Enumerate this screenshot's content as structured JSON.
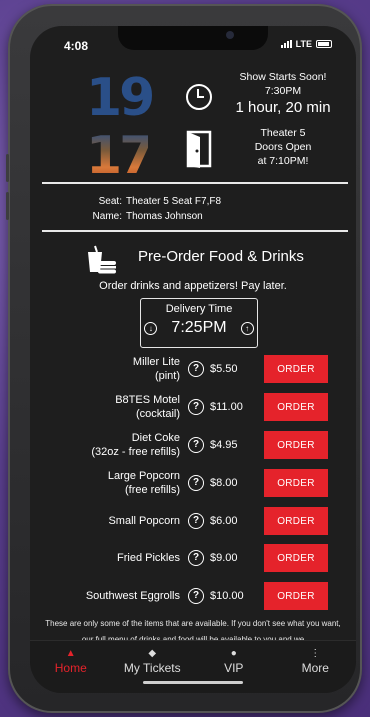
{
  "status": {
    "time": "4:08",
    "network": "LTE"
  },
  "poster": {
    "line1": "19",
    "line2": "17"
  },
  "show": {
    "heading": "Show Starts Soon!",
    "time": "7:30PM",
    "countdown": "1 hour, 20 min"
  },
  "theater": {
    "name": "Theater 5",
    "line2": "Doors Open",
    "line3": "at 7:10PM!"
  },
  "ticket": {
    "seat_label": "Seat:",
    "seat_value": "Theater 5 Seat F7,F8",
    "name_label": "Name:",
    "name_value": "Thomas Johnson"
  },
  "preorder": {
    "title": "Pre-Order Food & Drinks",
    "subtitle": "Order drinks and appetizers! Pay later."
  },
  "delivery": {
    "label": "Delivery Time",
    "time": "7:25PM"
  },
  "menu": [
    {
      "line1": "Miller Lite",
      "line2": "(pint)",
      "price": "$5.50",
      "order": "ORDER"
    },
    {
      "line1": "B8TES Motel",
      "line2": "(cocktail)",
      "price": "$11.00",
      "order": "ORDER"
    },
    {
      "line1": "Diet Coke",
      "line2": "(32oz - free refills)",
      "price": "$4.95",
      "order": "ORDER"
    },
    {
      "line1": "Large Popcorn",
      "line2": "(free refills)",
      "price": "$8.00",
      "order": "ORDER"
    },
    {
      "line1": "Small Popcorn",
      "line2": "",
      "price": "$6.00",
      "order": "ORDER"
    },
    {
      "line1": "Fried Pickles",
      "line2": "",
      "price": "$9.00",
      "order": "ORDER"
    },
    {
      "line1": "Southwest Eggrolls",
      "line2": "",
      "price": "$10.00",
      "order": "ORDER"
    }
  ],
  "footnote": "These are only some of the items that are available. If you don't see what you want, our full menu of drinks and food will be available to you and we",
  "tabs": [
    {
      "label": "Home",
      "icon": "home-icon"
    },
    {
      "label": "My Tickets",
      "icon": "ticket-icon"
    },
    {
      "label": "VIP",
      "icon": "person-icon"
    },
    {
      "label": "More",
      "icon": "more-icon"
    }
  ],
  "colors": {
    "accent": "#e5232b",
    "background": "#1e1e1e"
  }
}
